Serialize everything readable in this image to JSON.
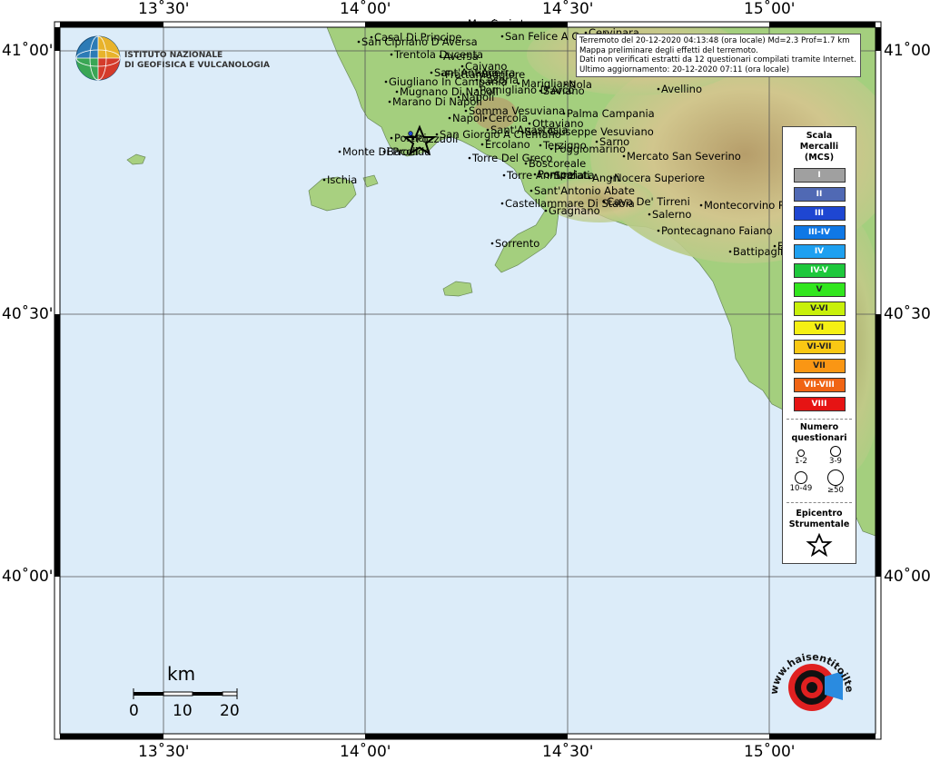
{
  "axis": {
    "top": [
      "13˚30'",
      "14˚00'",
      "14˚30'",
      "15˚00'"
    ],
    "bottom": [
      "13˚30'",
      "14˚00'",
      "14˚30'",
      "15˚00'"
    ],
    "left": [
      "41˚00'",
      "40˚30'",
      "40˚00'"
    ],
    "right": [
      "41˚00'",
      "40˚30'",
      "40˚00'"
    ]
  },
  "ingv": {
    "line1": "ISTITUTO NAZIONALE",
    "line2": "DI GEOFISICA E VULCANOLOGIA"
  },
  "info": {
    "line1": "Terremoto del 20-12-2020 04:13:48 (ora locale) Md=2.3 Prof=1.7 km",
    "line2": "Mappa preliminare degli effetti del terremoto.",
    "line3": "Dati non verificati estratti da 12 questionari compilati tramite Internet.",
    "line4": "Ultimo aggiornamento: 20-12-2020 07:11 (ora locale)"
  },
  "places": [
    {
      "name": "Marcianise"
    },
    {
      "name": "Caserta"
    },
    {
      "name": "Casal Di Principe"
    },
    {
      "name": "San Cipriano D'Aversa"
    },
    {
      "name": "San Felice A Cancello"
    },
    {
      "name": "Cervinara"
    },
    {
      "name": "Trentola Ducenta"
    },
    {
      "name": "Aversa"
    },
    {
      "name": "Caivano"
    },
    {
      "name": "Acerra"
    },
    {
      "name": "Sant'Antimo"
    },
    {
      "name": "Frattamaggiore"
    },
    {
      "name": "Giugliano In Campania"
    },
    {
      "name": "Casoria"
    },
    {
      "name": "Marigliano"
    },
    {
      "name": "Nola"
    },
    {
      "name": "Mugnano Di Napoli"
    },
    {
      "name": "Pomigliano D'Arco"
    },
    {
      "name": "Saviano"
    },
    {
      "name": "Marano Di Napoli"
    },
    {
      "name": "Napoli"
    },
    {
      "name": "Avellino"
    },
    {
      "name": "Somma Vesuviana"
    },
    {
      "name": "Napoli"
    },
    {
      "name": "Cercola"
    },
    {
      "name": "Ottaviano"
    },
    {
      "name": "San Giuseppe Vesuviano"
    },
    {
      "name": "Sant'Anastasia"
    },
    {
      "name": "Palma Campania"
    },
    {
      "name": "San Giorgio A Cremano"
    },
    {
      "name": "Portici"
    },
    {
      "name": "Pozzuoli"
    },
    {
      "name": "Monte Di Procida"
    },
    {
      "name": "Bacoli"
    },
    {
      "name": "Ercolano"
    },
    {
      "name": "Terzigno"
    },
    {
      "name": "Sarno"
    },
    {
      "name": "Torre Del Greco"
    },
    {
      "name": "Poggiomarino"
    },
    {
      "name": "Mercato San Severino"
    },
    {
      "name": "Boscoreale"
    },
    {
      "name": "Torre Annunziata"
    },
    {
      "name": "Pompei"
    },
    {
      "name": "Scafati"
    },
    {
      "name": "Angri"
    },
    {
      "name": "Nocera Superiore"
    },
    {
      "name": "Ischia"
    },
    {
      "name": "Sant'Antonio Abate"
    },
    {
      "name": "Castellammare Di Stabia"
    },
    {
      "name": "Cava De' Tirreni"
    },
    {
      "name": "Gragnano"
    },
    {
      "name": "Montecorvino Rovella"
    },
    {
      "name": "Salerno"
    },
    {
      "name": "Pontecagnano Faiano"
    },
    {
      "name": "Sorrento"
    },
    {
      "name": "Battipaglia"
    },
    {
      "name": "Eboli"
    }
  ],
  "legend": {
    "title1": "Scala",
    "title2": "Mercalli",
    "title3": "(MCS)",
    "classes": [
      {
        "label": "I",
        "color": "#a0a0a0"
      },
      {
        "label": "II",
        "color": "#5069b4"
      },
      {
        "label": "III",
        "color": "#1e46d2"
      },
      {
        "label": "III-IV",
        "color": "#0f78e6"
      },
      {
        "label": "IV",
        "color": "#1ea0f0"
      },
      {
        "label": "IV-V",
        "color": "#1ec83c"
      },
      {
        "label": "V",
        "color": "#32e61e"
      },
      {
        "label": "V-VI",
        "color": "#c8f00a"
      },
      {
        "label": "VI",
        "color": "#f5f014"
      },
      {
        "label": "VI-VII",
        "color": "#fac814"
      },
      {
        "label": "VII",
        "color": "#fa9614"
      },
      {
        "label": "VII-VIII",
        "color": "#f06414"
      },
      {
        "label": "VIII",
        "color": "#e61414"
      }
    ],
    "questionari_title1": "Numero",
    "questionari_title2": "questionari",
    "q_classes": [
      "1-2",
      "3-9",
      "10-49",
      "≥50"
    ],
    "epicentro1": "Epicentro",
    "epicentro2": "Strumentale"
  },
  "scale": {
    "unit": "km",
    "ticks": [
      "0",
      "10",
      "20"
    ]
  },
  "hsit": {
    "text": "www.haisentitoilterremoto.it"
  },
  "colors": {
    "sea": "#dcecf9",
    "land": "#9cc97a",
    "grid": "#555555"
  }
}
